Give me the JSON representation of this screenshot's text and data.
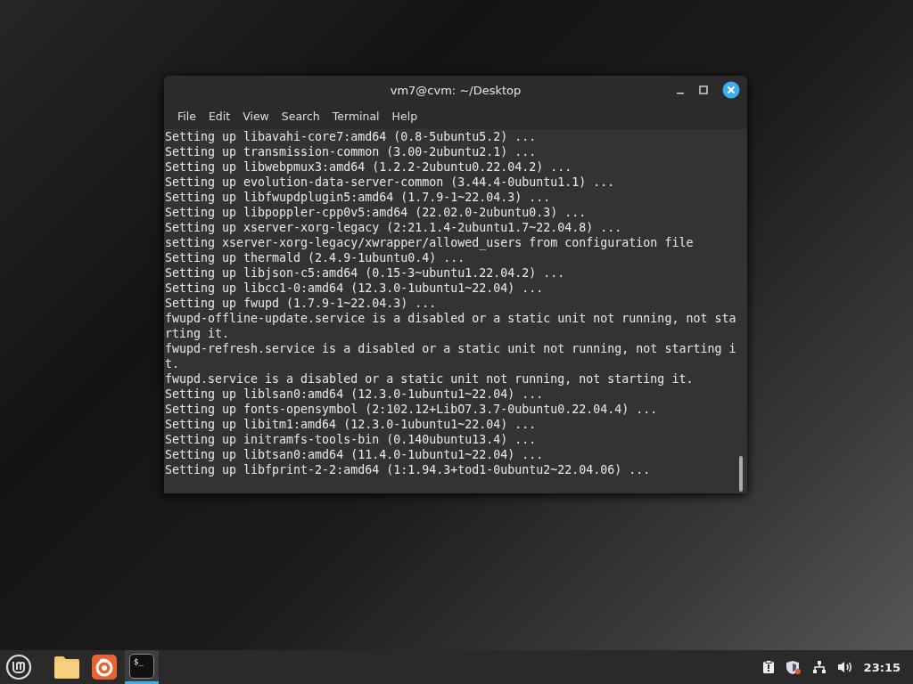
{
  "window": {
    "title": "vm7@cvm: ~/Desktop"
  },
  "menu": [
    "File",
    "Edit",
    "View",
    "Search",
    "Terminal",
    "Help"
  ],
  "terminal_lines": [
    "Setting up libavahi-core7:amd64 (0.8-5ubuntu5.2) ...",
    "Setting up transmission-common (3.00-2ubuntu2.1) ...",
    "Setting up libwebpmux3:amd64 (1.2.2-2ubuntu0.22.04.2) ...",
    "Setting up evolution-data-server-common (3.44.4-0ubuntu1.1) ...",
    "Setting up libfwupdplugin5:amd64 (1.7.9-1~22.04.3) ...",
    "Setting up libpoppler-cpp0v5:amd64 (22.02.0-2ubuntu0.3) ...",
    "Setting up xserver-xorg-legacy (2:21.1.4-2ubuntu1.7~22.04.8) ...",
    "setting xserver-xorg-legacy/xwrapper/allowed_users from configuration file",
    "Setting up thermald (2.4.9-1ubuntu0.4) ...",
    "Setting up libjson-c5:amd64 (0.15-3~ubuntu1.22.04.2) ...",
    "Setting up libcc1-0:amd64 (12.3.0-1ubuntu1~22.04) ...",
    "Setting up fwupd (1.7.9-1~22.04.3) ...",
    "fwupd-offline-update.service is a disabled or a static unit not running, not sta",
    "rting it.",
    "fwupd-refresh.service is a disabled or a static unit not running, not starting i",
    "t.",
    "fwupd.service is a disabled or a static unit not running, not starting it.",
    "Setting up liblsan0:amd64 (12.3.0-1ubuntu1~22.04) ...",
    "Setting up fonts-opensymbol (2:102.12+LibO7.3.7-0ubuntu0.22.04.4) ...",
    "Setting up libitm1:amd64 (12.3.0-1ubuntu1~22.04) ...",
    "Setting up initramfs-tools-bin (0.140ubuntu13.4) ...",
    "Setting up libtsan0:amd64 (11.4.0-1ubuntu1~22.04) ...",
    "Setting up libfprint-2-2:amd64 (1:1.94.3+tod1-0ubuntu2~22.04.06) ..."
  ],
  "taskbar": {
    "apps": [
      {
        "kind": "folder",
        "selected": false
      },
      {
        "kind": "browser",
        "selected": false
      },
      {
        "kind": "terminal",
        "label": "$_",
        "selected": true
      }
    ],
    "clock": "23:15"
  }
}
